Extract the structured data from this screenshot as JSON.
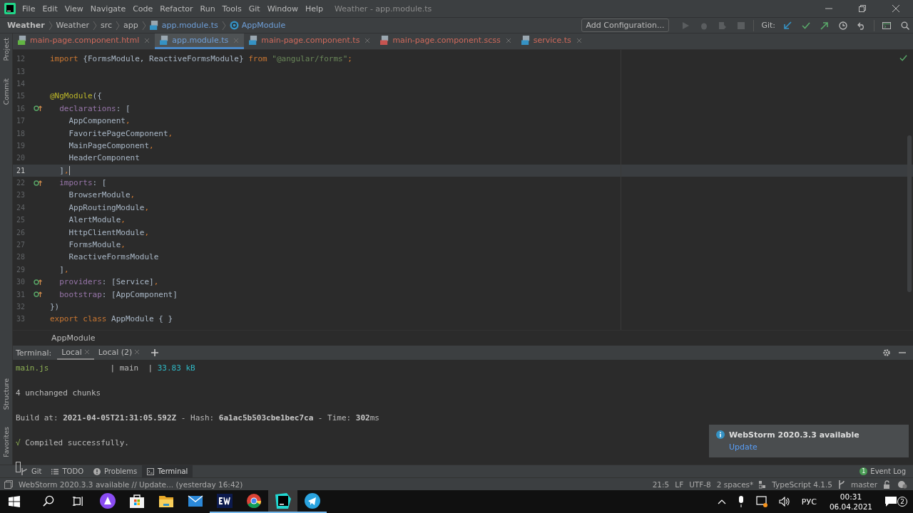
{
  "menu_bar": {
    "items": [
      "File",
      "Edit",
      "View",
      "Navigate",
      "Code",
      "Refactor",
      "Run",
      "Tools",
      "Git",
      "Window",
      "Help"
    ],
    "title": "Weather - app.module.ts"
  },
  "nav_bar": {
    "crumbs": [
      {
        "text": "Weather",
        "kind": "project"
      },
      {
        "text": "Weather",
        "kind": "folder"
      },
      {
        "text": "src",
        "kind": "folder"
      },
      {
        "text": "app",
        "kind": "folder"
      },
      {
        "text": "app.module.ts",
        "kind": "file"
      },
      {
        "text": "AppModule",
        "kind": "class"
      }
    ],
    "run_config": "Add Configuration...",
    "git_label": "Git:"
  },
  "side_tools_top": [
    "Project",
    "Commit"
  ],
  "side_tools_bottom": [
    "Structure",
    "Favorites"
  ],
  "editor_tabs": [
    {
      "label": "main-page.component.html",
      "kind": "html",
      "selected": false,
      "color": "#cf6a5c"
    },
    {
      "label": "app.module.ts",
      "kind": "ts",
      "selected": true,
      "color": "#6f9fd8"
    },
    {
      "label": "main-page.component.ts",
      "kind": "ts",
      "selected": false,
      "color": "#cf6a5c"
    },
    {
      "label": "main-page.component.scss",
      "kind": "scss",
      "selected": false,
      "color": "#cf6a5c"
    },
    {
      "label": "service.ts",
      "kind": "ts",
      "selected": false,
      "color": "#cf6a5c"
    }
  ],
  "code_lines": [
    {
      "number": "12",
      "gutter_mark": false,
      "current": false,
      "tokens": [
        {
          "text": "import",
          "kind": "keyword"
        },
        {
          "text": " {FormsModule, ReactiveFormsModule} ",
          "kind": "plain"
        },
        {
          "text": "from",
          "kind": "keyword"
        },
        {
          "text": " \"@angular/forms\"",
          "kind": "string"
        },
        {
          "text": ";",
          "kind": "keyword"
        }
      ]
    },
    {
      "number": "13",
      "gutter_mark": false,
      "current": false
    },
    {
      "number": "14",
      "gutter_mark": false,
      "current": false
    },
    {
      "number": "15",
      "gutter_mark": false,
      "current": false,
      "tokens": [
        {
          "text": "@NgModule",
          "kind": "decorator"
        },
        {
          "text": "({",
          "kind": "plain"
        }
      ]
    },
    {
      "number": "16",
      "gutter_mark": true,
      "current": false,
      "tokens": [
        {
          "text": "  declarations",
          "kind": "property"
        },
        {
          "text": ": [",
          "kind": "plain"
        }
      ]
    },
    {
      "number": "17",
      "gutter_mark": false,
      "current": false,
      "tokens": [
        {
          "text": "    AppComponent",
          "kind": "plain"
        },
        {
          "text": ",",
          "kind": "keyword"
        }
      ]
    },
    {
      "number": "18",
      "gutter_mark": false,
      "current": false,
      "tokens": [
        {
          "text": "    FavoritePageComponent",
          "kind": "plain"
        },
        {
          "text": ",",
          "kind": "keyword"
        }
      ]
    },
    {
      "number": "19",
      "gutter_mark": false,
      "current": false,
      "tokens": [
        {
          "text": "    MainPageComponent",
          "kind": "plain"
        },
        {
          "text": ",",
          "kind": "keyword"
        }
      ]
    },
    {
      "number": "20",
      "gutter_mark": false,
      "current": false,
      "tokens": [
        {
          "text": "    HeaderComponent",
          "kind": "plain"
        }
      ]
    },
    {
      "number": "21",
      "gutter_mark": false,
      "current": true,
      "tokens": [
        {
          "text": "  ]",
          "kind": "plain"
        },
        {
          "text": ",",
          "kind": "keyword"
        }
      ]
    },
    {
      "number": "22",
      "gutter_mark": true,
      "current": false,
      "tokens": [
        {
          "text": "  imports",
          "kind": "property"
        },
        {
          "text": ": [",
          "kind": "plain"
        }
      ]
    },
    {
      "number": "23",
      "gutter_mark": false,
      "current": false,
      "tokens": [
        {
          "text": "    BrowserModule",
          "kind": "plain"
        },
        {
          "text": ",",
          "kind": "keyword"
        }
      ]
    },
    {
      "number": "24",
      "gutter_mark": false,
      "current": false,
      "tokens": [
        {
          "text": "    AppRoutingModule",
          "kind": "plain"
        },
        {
          "text": ",",
          "kind": "keyword"
        }
      ]
    },
    {
      "number": "25",
      "gutter_mark": false,
      "current": false,
      "tokens": [
        {
          "text": "    AlertModule",
          "kind": "plain"
        },
        {
          "text": ",",
          "kind": "keyword"
        }
      ]
    },
    {
      "number": "26",
      "gutter_mark": false,
      "current": false,
      "tokens": [
        {
          "text": "    HttpClientModule",
          "kind": "plain"
        },
        {
          "text": ",",
          "kind": "keyword"
        }
      ]
    },
    {
      "number": "27",
      "gutter_mark": false,
      "current": false,
      "tokens": [
        {
          "text": "    FormsModule",
          "kind": "plain"
        },
        {
          "text": ",",
          "kind": "keyword"
        }
      ]
    },
    {
      "number": "28",
      "gutter_mark": false,
      "current": false,
      "tokens": [
        {
          "text": "    ReactiveFormsModule",
          "kind": "plain"
        }
      ]
    },
    {
      "number": "29",
      "gutter_mark": false,
      "current": false,
      "tokens": [
        {
          "text": "  ]",
          "kind": "plain"
        },
        {
          "text": ",",
          "kind": "keyword"
        }
      ]
    },
    {
      "number": "30",
      "gutter_mark": true,
      "current": false,
      "tokens": [
        {
          "text": "  providers",
          "kind": "property"
        },
        {
          "text": ": [Service]",
          "kind": "plain"
        },
        {
          "text": ",",
          "kind": "keyword"
        }
      ]
    },
    {
      "number": "31",
      "gutter_mark": true,
      "current": false,
      "tokens": [
        {
          "text": "  bootstrap",
          "kind": "property"
        },
        {
          "text": ": [AppComponent]",
          "kind": "plain"
        }
      ]
    },
    {
      "number": "32",
      "gutter_mark": false,
      "current": false,
      "tokens": [
        {
          "text": "})",
          "kind": "plain"
        }
      ]
    },
    {
      "number": "33",
      "gutter_mark": false,
      "current": false,
      "tokens": [
        {
          "text": "export class",
          "kind": "keyword"
        },
        {
          "text": " AppModule { }",
          "kind": "plain"
        }
      ]
    }
  ],
  "breadcrumb": "AppModule",
  "terminal": {
    "label": "Terminal:",
    "tabs": [
      {
        "label": "Local",
        "selected": true
      },
      {
        "label": "Local (2)",
        "selected": false
      }
    ],
    "lines": [
      {
        "tokens": [
          {
            "text": "main.js",
            "kind": "green"
          },
          {
            "text": "             | main  | ",
            "kind": "plain"
          },
          {
            "text": "33.83 kB",
            "kind": "cyan"
          }
        ]
      },
      {
        "tokens": [
          {
            "text": "4 unchanged chunks",
            "kind": "plain"
          }
        ]
      },
      {
        "tokens": [
          {
            "text": "Build at: ",
            "kind": "plain"
          },
          {
            "text": "2021-04-05T21:31:05.592Z",
            "kind": "bold"
          },
          {
            "text": " - Hash: ",
            "kind": "plain"
          },
          {
            "text": "6a1ac5b503cbe1bec7ca",
            "kind": "bold"
          },
          {
            "text": " - Time: ",
            "kind": "plain"
          },
          {
            "text": "302",
            "kind": "bold"
          },
          {
            "text": "ms",
            "kind": "plain"
          }
        ]
      },
      {
        "tokens": [
          {
            "text": "√",
            "kind": "green"
          },
          {
            "text": " Compiled successfully.",
            "kind": "plain"
          }
        ]
      }
    ]
  },
  "notification": {
    "title": "WebStorm 2020.3.3 available",
    "link": "Update"
  },
  "tool_tabs": [
    {
      "label": "Git",
      "kind": "git",
      "selected": false
    },
    {
      "label": "TODO",
      "kind": "todo",
      "selected": false
    },
    {
      "label": "Problems",
      "kind": "problems",
      "selected": false
    },
    {
      "label": "Terminal",
      "kind": "terminal",
      "selected": true
    }
  ],
  "event_log": {
    "count": "1",
    "label": "Event Log"
  },
  "status_bar": {
    "message": "WebStorm 2020.3.3 available // Update... (yesterday 16:42)",
    "position": "21:5",
    "line_ending": "LF",
    "encoding": "UTF-8",
    "indent": "2 spaces*",
    "language": "TypeScript 4.1.5",
    "branch": "master"
  },
  "taskbar": {
    "apps": [
      {
        "kind": "search",
        "running": false,
        "selected": false
      },
      {
        "kind": "taskview",
        "running": false,
        "selected": false
      },
      {
        "kind": "assistant",
        "running": false,
        "selected": false
      },
      {
        "kind": "store",
        "running": false,
        "selected": false
      },
      {
        "kind": "explorer",
        "running": false,
        "selected": false
      },
      {
        "kind": "mail",
        "running": false,
        "selected": false
      },
      {
        "kind": "ew",
        "running": true,
        "selected": false
      },
      {
        "kind": "chrome",
        "running": true,
        "selected": false
      },
      {
        "kind": "webstorm",
        "running": true,
        "selected": true
      },
      {
        "kind": "telegram",
        "running": true,
        "selected": false
      }
    ],
    "tray": {
      "language": "РУС",
      "time": "00:31",
      "date": "06.04.2021",
      "notifications": "2"
    }
  }
}
